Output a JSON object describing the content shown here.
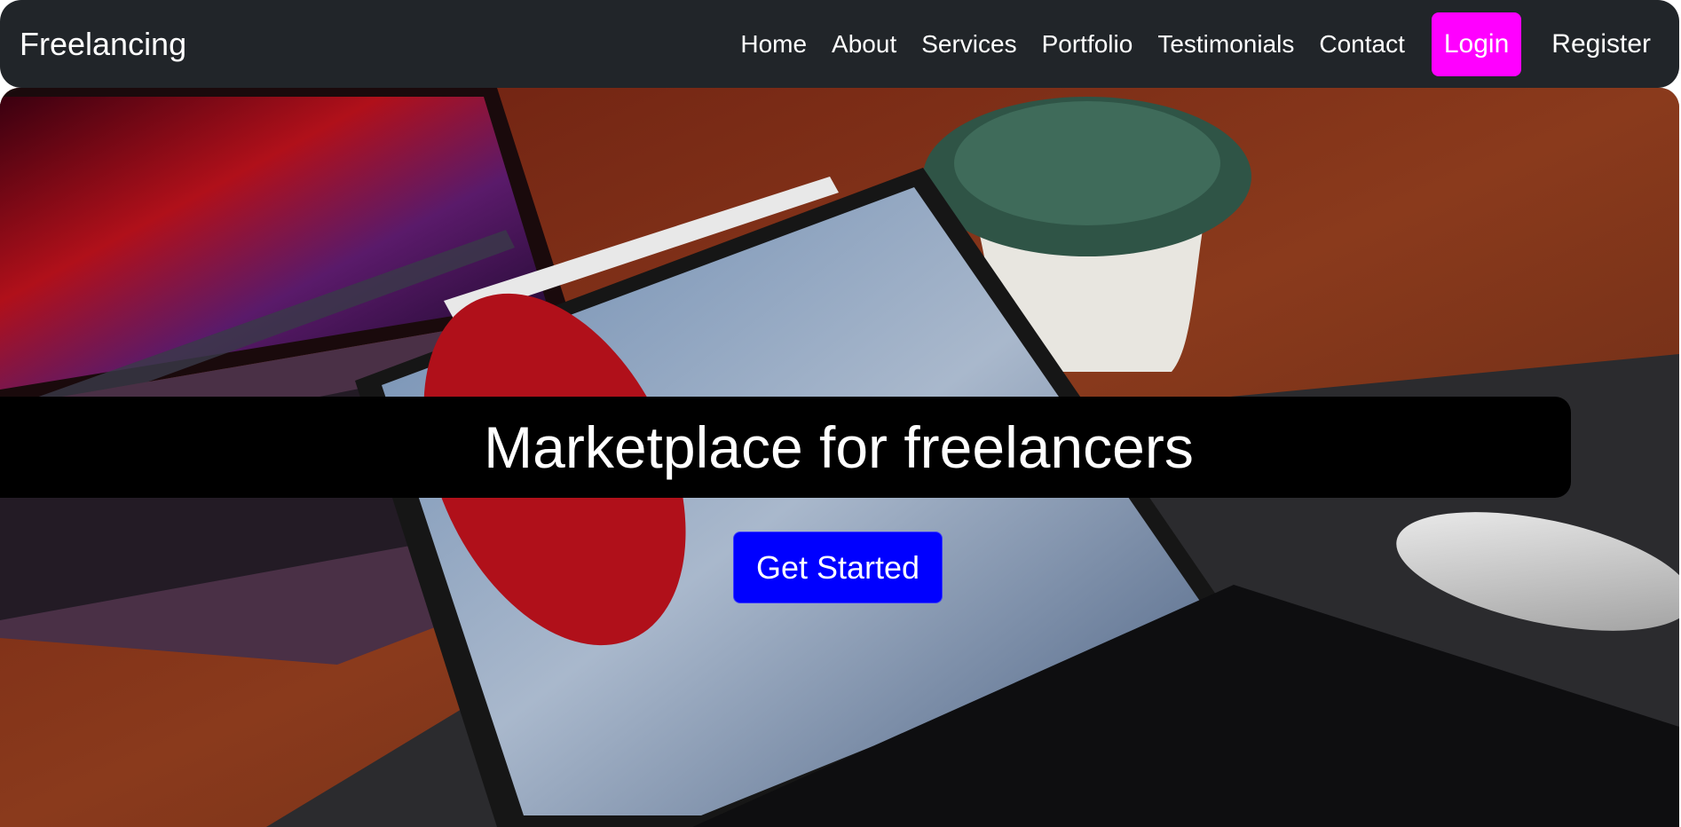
{
  "navbar": {
    "brand": "Freelancing",
    "links": [
      "Home",
      "About",
      "Services",
      "Portfolio",
      "Testimonials",
      "Contact"
    ],
    "login_label": "Login",
    "register_label": "Register"
  },
  "hero": {
    "headline": "Marketplace for freelancers",
    "cta_label": "Get Started",
    "background_image": "desk-with-laptop-tablet-keyboard-plant-mouse"
  },
  "colors": {
    "navbar_bg": "#212529",
    "login_bg": "#ff00ff",
    "cta_bg": "#0000ff",
    "headline_band": "#000000",
    "text": "#ffffff"
  }
}
